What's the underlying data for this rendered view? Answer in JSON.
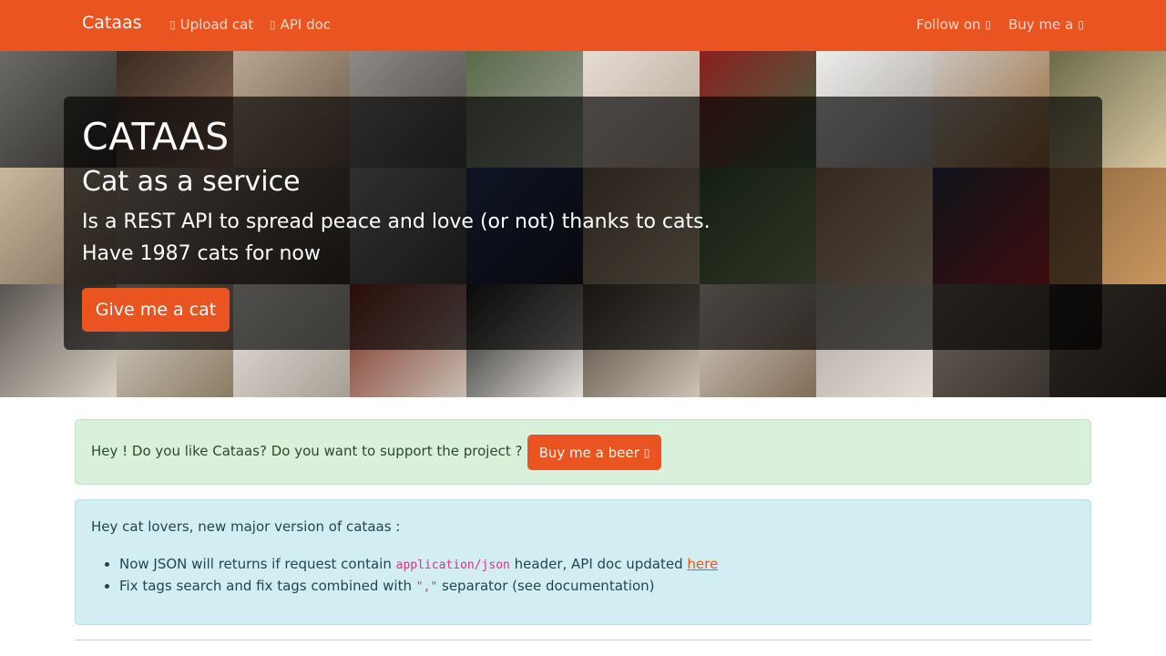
{
  "navbar": {
    "brand": "Cataas",
    "links": [
      {
        "label": "Upload cat",
        "icon": "upload-icon"
      },
      {
        "label": "API doc",
        "icon": "book-icon"
      }
    ],
    "right_links": [
      {
        "label": "Follow on",
        "icon": "social-icon"
      },
      {
        "label": "Buy me a",
        "icon": "beer-icon"
      }
    ],
    "color": "#e95420"
  },
  "hero": {
    "title": "CATAAS",
    "subtitle": "Cat as a service",
    "lead_1": "Is a REST API to spread peace and love (or not) thanks to cats.",
    "lead_2": "Have 1987 cats for now",
    "button_label": "Give me a cat"
  },
  "support_alert": {
    "text": "Hey ! Do you like Cataas? Do you want to support the project ?",
    "button_label": "Buy me a beer",
    "button_icon": "beer-icon"
  },
  "news_alert": {
    "heading": "Hey cat lovers, new major version of cataas :",
    "item_1": {
      "before": "Now JSON will returns if request contain",
      "code": "application/json",
      "middle": "header, API doc updated",
      "link": "here"
    },
    "item_2": {
      "before": "Fix tags search and fix tags combined with",
      "code": "\",\"",
      "after": "separator (see documentation)"
    }
  },
  "colors": {
    "accent": "#e95420",
    "success_bg": "#d9f1da",
    "info_bg": "#d3eef2"
  }
}
